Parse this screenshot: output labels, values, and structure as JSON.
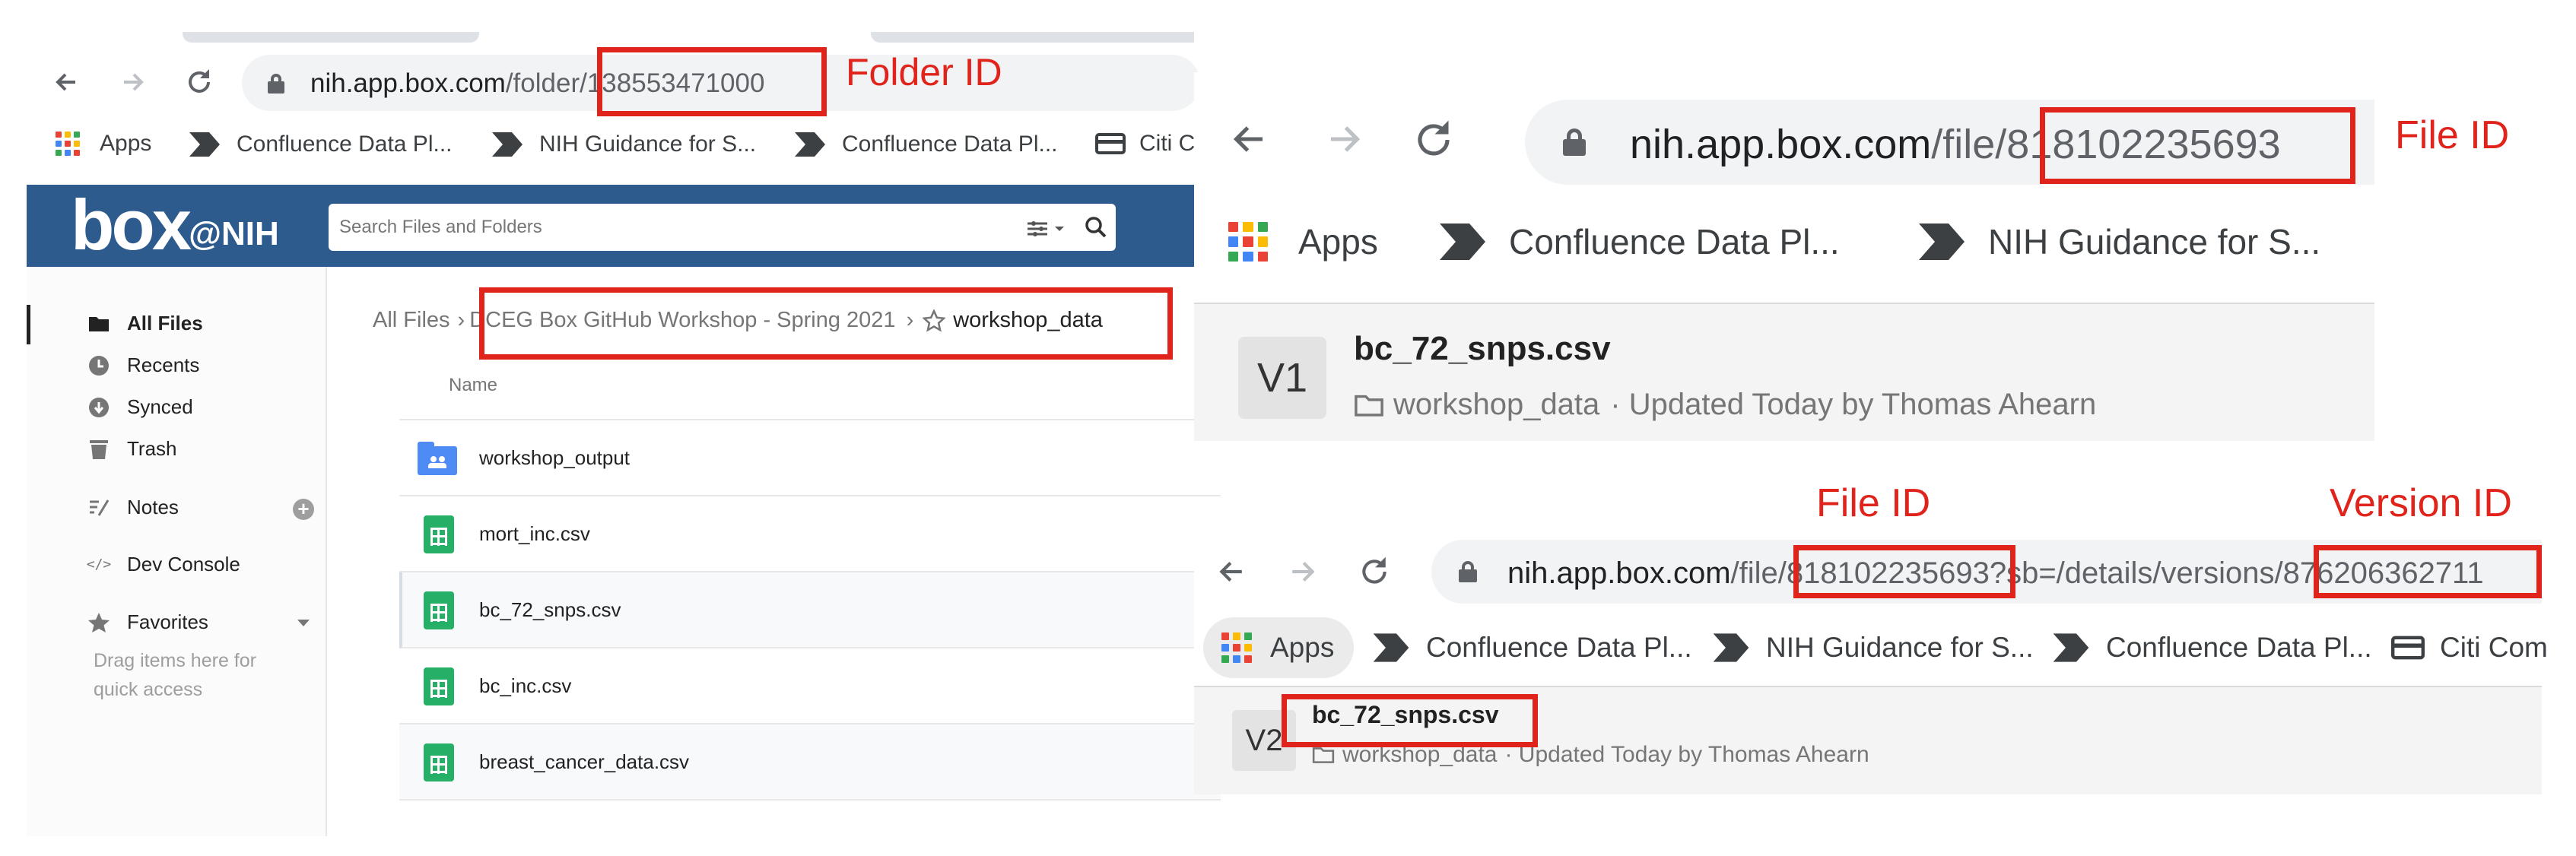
{
  "colors": {
    "annotation_red": "#e0241b",
    "box_blue": "#2d5b8e",
    "sheet_green": "#26b067",
    "folder_blue": "#4e8bf5"
  },
  "left": {
    "url": {
      "host": "nih.app.box.com",
      "path": "/folder/",
      "id": "138553471000"
    },
    "annotation": "Folder ID",
    "bookmarks": {
      "apps": "Apps",
      "items": [
        "Confluence Data Pl...",
        "NIH Guidance for S...",
        "Confluence Data Pl...",
        "Citi C"
      ]
    },
    "box_header": {
      "logo_box": "box",
      "logo_suffix": "@NIH",
      "search_placeholder": "Search Files and Folders"
    },
    "sidebar": {
      "items": [
        {
          "label": "All Files",
          "icon": "folder-icon"
        },
        {
          "label": "Recents",
          "icon": "clock-icon"
        },
        {
          "label": "Synced",
          "icon": "sync-icon"
        },
        {
          "label": "Trash",
          "icon": "trash-icon"
        },
        {
          "label": "Notes",
          "icon": "notes-icon"
        },
        {
          "label": "Dev Console",
          "icon": "code-icon"
        },
        {
          "label": "Favorites",
          "icon": "star-icon"
        }
      ],
      "favorites_hint_line1": "Drag items here for",
      "favorites_hint_line2": "quick access"
    },
    "breadcrumb": {
      "root": "All Files",
      "sep": "›",
      "folder": "DCEG Box GitHub Workshop - Spring 2021",
      "current": "workshop_data"
    },
    "table_header": "Name",
    "files": [
      "workshop_output",
      "mort_inc.csv",
      "bc_72_snps.csv",
      "bc_inc.csv",
      "breast_cancer_data.csv"
    ]
  },
  "right_top": {
    "url": {
      "host": "nih.app.box.com",
      "path": "/file/",
      "id": "818102235693"
    },
    "annotation": "File ID",
    "bookmarks": {
      "apps": "Apps",
      "items": [
        "Confluence Data Pl...",
        "NIH Guidance for S..."
      ]
    },
    "version_badge": "V1",
    "file_name": "bc_72_snps.csv",
    "folder": "workshop_data",
    "updated": "· Updated Today by Thomas Ahearn"
  },
  "right_bottom": {
    "url": {
      "host": "nih.app.box.com",
      "path": "/file/",
      "file_id": "818102235693",
      "mid": "?sb=/details/versions/",
      "version_id": "876206362711"
    },
    "annotation_file": "File ID",
    "annotation_version": "Version ID",
    "bookmarks": {
      "apps": "Apps",
      "items": [
        "Confluence Data Pl...",
        "NIH Guidance for S...",
        "Confluence Data Pl...",
        "Citi Com"
      ]
    },
    "version_badge": "V2",
    "file_name": "bc_72_snps.csv",
    "folder": "workshop_data",
    "updated": "· Updated Today by Thomas Ahearn"
  }
}
